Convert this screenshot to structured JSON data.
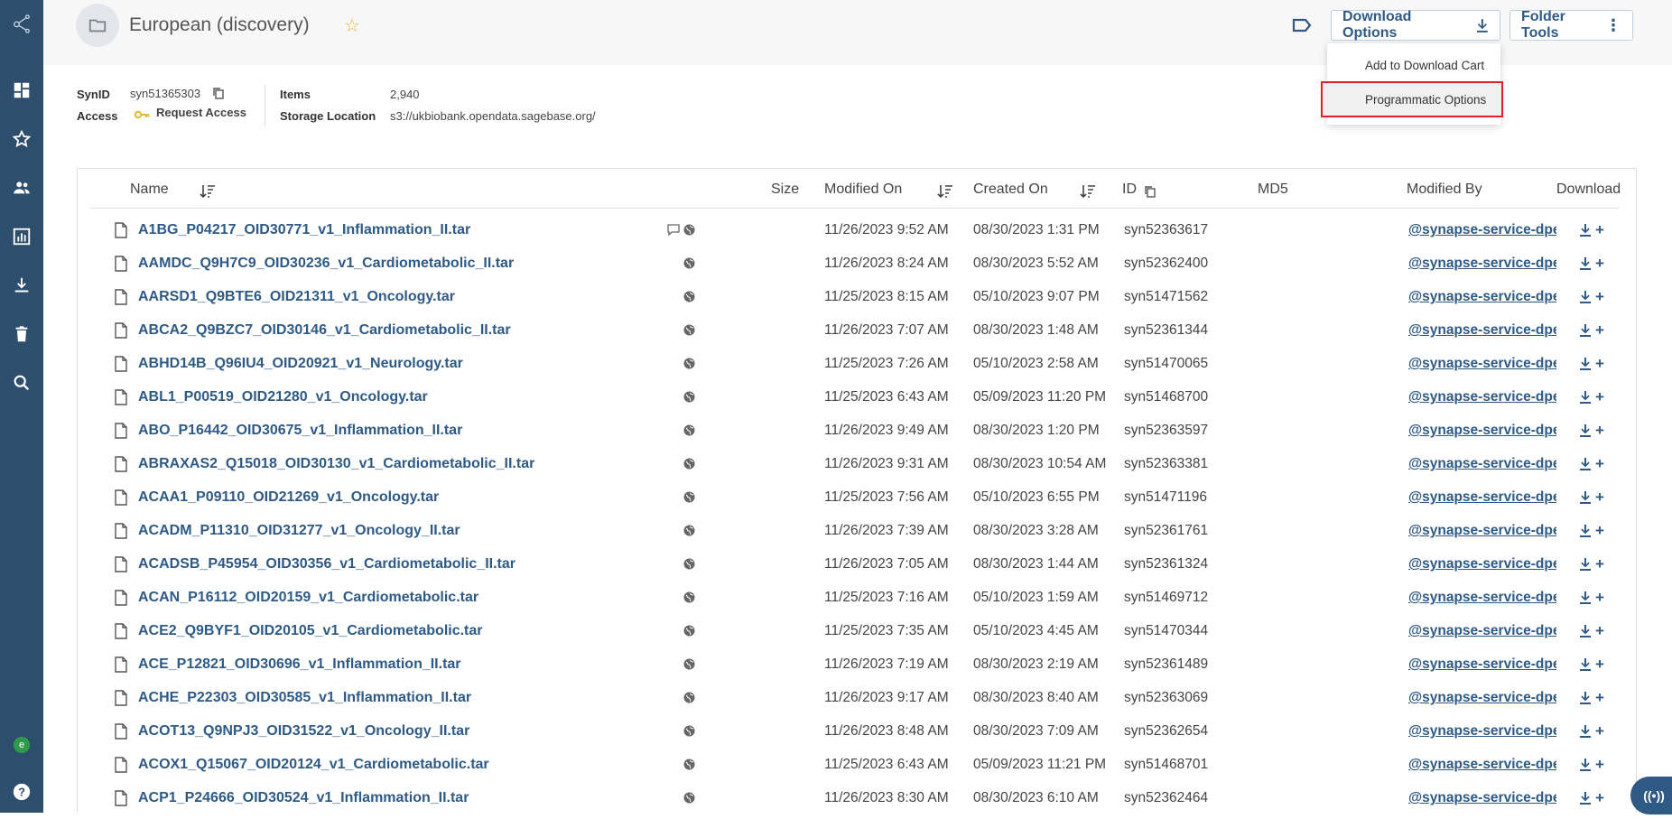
{
  "header": {
    "title": "European (discovery)",
    "download_options_label": "Download Options",
    "folder_tools_label": "Folder Tools"
  },
  "dropdown": {
    "items": [
      "Add to Download Cart",
      "Programmatic Options"
    ],
    "highlighted": "Programmatic Options"
  },
  "meta": {
    "synid_label": "SynID",
    "synid_value": "syn51365303",
    "access_label": "Access",
    "access_value": "Request Access",
    "items_label": "Items",
    "items_value": "2,940",
    "storage_label": "Storage Location",
    "storage_value": "s3://ukbiobank.opendata.sagebase.org/"
  },
  "table": {
    "columns": [
      "Name",
      "Size",
      "Modified On",
      "Created On",
      "ID",
      "MD5",
      "Modified By",
      "Download"
    ],
    "rows": [
      {
        "name": "A1BG_P04217_OID30771_v1_Inflammation_II.tar",
        "modified": "11/26/2023 9:52 AM",
        "created": "08/30/2023 1:31 PM",
        "id": "syn52363617",
        "by": "@synapse-service-dpe",
        "comment": true
      },
      {
        "name": "AAMDC_Q9H7C9_OID30236_v1_Cardiometabolic_II.tar",
        "modified": "11/26/2023 8:24 AM",
        "created": "08/30/2023 5:52 AM",
        "id": "syn52362400",
        "by": "@synapse-service-dpe"
      },
      {
        "name": "AARSD1_Q9BTE6_OID21311_v1_Oncology.tar",
        "modified": "11/25/2023 8:15 AM",
        "created": "05/10/2023 9:07 PM",
        "id": "syn51471562",
        "by": "@synapse-service-dpe"
      },
      {
        "name": "ABCA2_Q9BZC7_OID30146_v1_Cardiometabolic_II.tar",
        "modified": "11/26/2023 7:07 AM",
        "created": "08/30/2023 1:48 AM",
        "id": "syn52361344",
        "by": "@synapse-service-dpe"
      },
      {
        "name": "ABHD14B_Q96IU4_OID20921_v1_Neurology.tar",
        "modified": "11/25/2023 7:26 AM",
        "created": "05/10/2023 2:58 AM",
        "id": "syn51470065",
        "by": "@synapse-service-dpe"
      },
      {
        "name": "ABL1_P00519_OID21280_v1_Oncology.tar",
        "modified": "11/25/2023 6:43 AM",
        "created": "05/09/2023 11:20 PM",
        "id": "syn51468700",
        "by": "@synapse-service-dpe"
      },
      {
        "name": "ABO_P16442_OID30675_v1_Inflammation_II.tar",
        "modified": "11/26/2023 9:49 AM",
        "created": "08/30/2023 1:20 PM",
        "id": "syn52363597",
        "by": "@synapse-service-dpe"
      },
      {
        "name": "ABRAXAS2_Q15018_OID30130_v1_Cardiometabolic_II.tar",
        "modified": "11/26/2023 9:31 AM",
        "created": "08/30/2023 10:54 AM",
        "id": "syn52363381",
        "by": "@synapse-service-dpe"
      },
      {
        "name": "ACAA1_P09110_OID21269_v1_Oncology.tar",
        "modified": "11/25/2023 7:56 AM",
        "created": "05/10/2023 6:55 PM",
        "id": "syn51471196",
        "by": "@synapse-service-dpe"
      },
      {
        "name": "ACADM_P11310_OID31277_v1_Oncology_II.tar",
        "modified": "11/26/2023 7:39 AM",
        "created": "08/30/2023 3:28 AM",
        "id": "syn52361761",
        "by": "@synapse-service-dpe"
      },
      {
        "name": "ACADSB_P45954_OID30356_v1_Cardiometabolic_II.tar",
        "modified": "11/26/2023 7:05 AM",
        "created": "08/30/2023 1:44 AM",
        "id": "syn52361324",
        "by": "@synapse-service-dpe"
      },
      {
        "name": "ACAN_P16112_OID20159_v1_Cardiometabolic.tar",
        "modified": "11/25/2023 7:16 AM",
        "created": "05/10/2023 1:59 AM",
        "id": "syn51469712",
        "by": "@synapse-service-dpe"
      },
      {
        "name": "ACE2_Q9BYF1_OID20105_v1_Cardiometabolic.tar",
        "modified": "11/25/2023 7:35 AM",
        "created": "05/10/2023 4:45 AM",
        "id": "syn51470344",
        "by": "@synapse-service-dpe"
      },
      {
        "name": "ACE_P12821_OID30696_v1_Inflammation_II.tar",
        "modified": "11/26/2023 7:19 AM",
        "created": "08/30/2023 2:19 AM",
        "id": "syn52361489",
        "by": "@synapse-service-dpe"
      },
      {
        "name": "ACHE_P22303_OID30585_v1_Inflammation_II.tar",
        "modified": "11/26/2023 9:17 AM",
        "created": "08/30/2023 8:40 AM",
        "id": "syn52363069",
        "by": "@synapse-service-dpe"
      },
      {
        "name": "ACOT13_Q9NPJ3_OID31522_v1_Oncology_II.tar",
        "modified": "11/26/2023 8:48 AM",
        "created": "08/30/2023 7:09 AM",
        "id": "syn52362654",
        "by": "@synapse-service-dpe"
      },
      {
        "name": "ACOX1_Q15067_OID20124_v1_Cardiometabolic.tar",
        "modified": "11/25/2023 6:43 AM",
        "created": "05/09/2023 11:21 PM",
        "id": "syn51468701",
        "by": "@synapse-service-dpe"
      },
      {
        "name": "ACP1_P24666_OID30524_v1_Inflammation_II.tar",
        "modified": "11/26/2023 8:30 AM",
        "created": "08/30/2023 6:10 AM",
        "id": "syn52362464",
        "by": "@synapse-service-dpe"
      }
    ]
  },
  "sidebar": {
    "icons": [
      "synapse-logo-icon",
      "dashboard-icon",
      "star-icon",
      "people-icon",
      "chart-icon",
      "download-icon",
      "trash-icon",
      "search-icon"
    ],
    "avatar_letter": "e"
  },
  "colors": {
    "sidebar": "#2e4e6e",
    "link": "#2e5a85",
    "highlight_border": "#e0202b"
  }
}
